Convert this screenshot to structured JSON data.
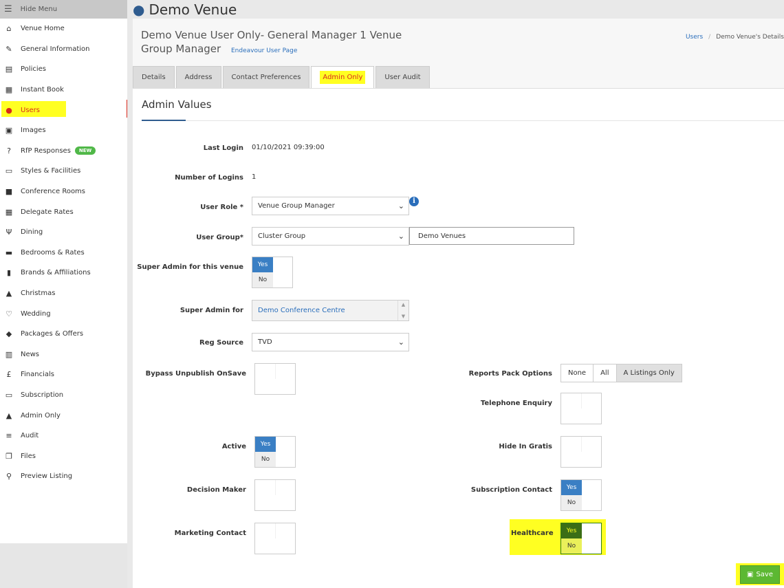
{
  "sidebar": {
    "hide_menu": "Hide Menu",
    "items": [
      {
        "label": "Venue Home",
        "icon": "home-icon"
      },
      {
        "label": "General Information",
        "icon": "edit-icon"
      },
      {
        "label": "Policies",
        "icon": "document-icon"
      },
      {
        "label": "Instant Book",
        "icon": "calendar-icon"
      },
      {
        "label": "Users",
        "icon": "user-icon"
      },
      {
        "label": "Images",
        "icon": "image-icon"
      },
      {
        "label": "RfP Responses",
        "icon": "question-icon",
        "badge": "NEW"
      },
      {
        "label": "Styles & Facilities",
        "icon": "monitor-icon"
      },
      {
        "label": "Conference Rooms",
        "icon": "briefcase-icon"
      },
      {
        "label": "Delegate Rates",
        "icon": "calculator-icon"
      },
      {
        "label": "Dining",
        "icon": "cutlery-icon"
      },
      {
        "label": "Bedrooms & Rates",
        "icon": "bed-icon"
      },
      {
        "label": "Brands & Affiliations",
        "icon": "book-icon"
      },
      {
        "label": "Christmas",
        "icon": "tree-icon"
      },
      {
        "label": "Wedding",
        "icon": "heart-icon"
      },
      {
        "label": "Packages & Offers",
        "icon": "tags-icon"
      },
      {
        "label": "News",
        "icon": "newspaper-icon"
      },
      {
        "label": "Financials",
        "icon": "pound-icon"
      },
      {
        "label": "Subscription",
        "icon": "card-icon"
      },
      {
        "label": "Admin Only",
        "icon": "warning-icon"
      },
      {
        "label": "Audit",
        "icon": "list-icon"
      },
      {
        "label": "Files",
        "icon": "files-icon"
      },
      {
        "label": "Preview Listing",
        "icon": "search-icon"
      }
    ]
  },
  "header": {
    "title": "Demo Venue",
    "subtitle": "Demo Venue User Only- General Manager 1 Venue Group Manager",
    "user_page_link": "Endeavour User Page",
    "breadcrumb": [
      "Users",
      "Demo Venue's Details"
    ]
  },
  "tabs": [
    "Details",
    "Address",
    "Contact Preferences",
    "Admin Only",
    "User Audit"
  ],
  "panel": {
    "title": "Admin Values",
    "last_login_label": "Last Login",
    "last_login_value": "01/10/2021 09:39:00",
    "logins_label": "Number of Logins",
    "logins_value": "1",
    "user_role_label": "User Role *",
    "user_role_value": "Venue Group Manager",
    "user_group_label": "User Group*",
    "user_group_value": "Cluster Group",
    "user_group_name": "Demo Venues",
    "super_admin_venue_label": "Super Admin for this venue",
    "super_admin_for_label": "Super Admin for",
    "super_admin_for_value": "Demo Conference Centre",
    "reg_source_label": "Reg Source",
    "reg_source_value": "TVD",
    "bypass_label": "Bypass Unpublish OnSave",
    "active_label": "Active",
    "decision_label": "Decision Maker",
    "marketing_label": "Marketing Contact",
    "reports_label": "Reports Pack Options",
    "reports_options": [
      "None",
      "All",
      "A Listings Only"
    ],
    "reports_selected": "A Listings Only",
    "telephone_label": "Telephone Enquiry",
    "hide_gratis_label": "Hide In Gratis",
    "subscription_label": "Subscription Contact",
    "healthcare_label": "Healthcare",
    "yes": "Yes",
    "no": "No"
  },
  "save_label": "Save",
  "colors": {
    "accent": "#2f5c8f",
    "highlight": "#ffff22",
    "active_red": "#d92a1c",
    "save_green": "#5cb832"
  }
}
